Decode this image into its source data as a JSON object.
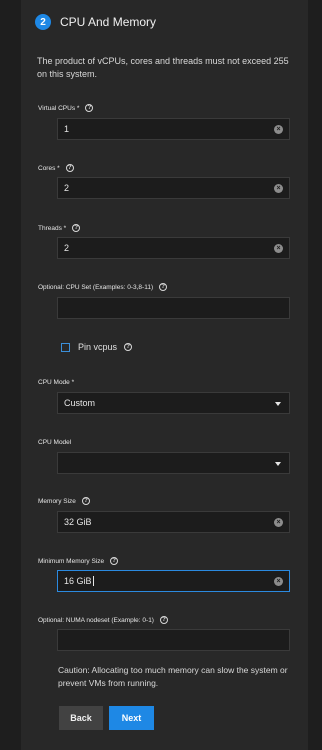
{
  "step": {
    "number": "2",
    "title": "CPU And Memory"
  },
  "intro_text": "The product of vCPUs, cores and threads must not exceed 255 on this system.",
  "fields": {
    "virtual_cpus": {
      "label": "Virtual CPUs *",
      "value": "1"
    },
    "cores": {
      "label": "Cores *",
      "value": "2"
    },
    "threads": {
      "label": "Threads *",
      "value": "2"
    },
    "cpu_set": {
      "label": "Optional: CPU Set (Examples: 0-3,8-11)",
      "value": ""
    },
    "pin_vcpus": {
      "label": "Pin vcpus",
      "checked": false
    },
    "cpu_mode": {
      "label": "CPU Mode *",
      "value": "Custom"
    },
    "cpu_model": {
      "label": "CPU Model",
      "value": ""
    },
    "memory_size": {
      "label": "Memory Size",
      "value": "32 GiB"
    },
    "min_memory_size": {
      "label": "Minimum Memory Size",
      "value": "16 GiB"
    },
    "numa_nodeset": {
      "label": "Optional: NUMA nodeset (Example: 0-1)",
      "value": ""
    }
  },
  "help_glyph": "?",
  "clear_glyph": "×",
  "caution_text": "Caution: Allocating too much memory can slow the system or prevent VMs from running.",
  "buttons": {
    "back": "Back",
    "next": "Next"
  },
  "colors": {
    "accent": "#1e88e5",
    "background": "#1e1e1e",
    "panel": "#282828",
    "input_bg": "#1c1c1c"
  }
}
